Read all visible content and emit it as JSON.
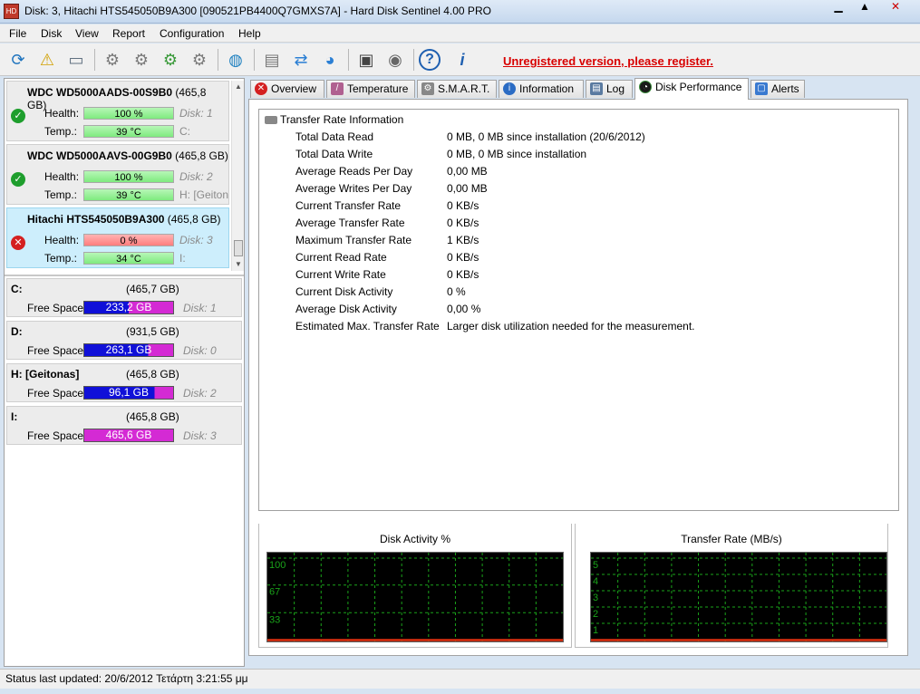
{
  "window": {
    "title": "Disk: 3, Hitachi HTS545050B9A300 [090521PB4400Q7GMXS7A]  -  Hard Disk Sentinel 4.00 PRO",
    "app_icon": "hds-app-icon",
    "controls": [
      "minimize",
      "maximize",
      "close"
    ]
  },
  "menu": {
    "items": [
      "File",
      "Disk",
      "View",
      "Report",
      "Configuration",
      "Help"
    ]
  },
  "toolbar": {
    "buttons": [
      {
        "name": "refresh-icon",
        "glyph": "⟳"
      },
      {
        "name": "warning-icon",
        "glyph": "⚠"
      },
      {
        "name": "disk-icon",
        "glyph": "▭"
      },
      {
        "name": "test-disk-icon",
        "glyph": "⚙"
      },
      {
        "name": "test-disk-2-icon",
        "glyph": "⚙"
      },
      {
        "name": "test-disk-ok-icon",
        "glyph": "⚙"
      },
      {
        "name": "test-disk-3-icon",
        "glyph": "⚙"
      },
      {
        "name": "globe-icon",
        "glyph": "◍"
      },
      {
        "name": "report-icon",
        "glyph": "▤"
      },
      {
        "name": "sync-icon",
        "glyph": "⇄"
      },
      {
        "name": "network-icon",
        "glyph": "◕"
      },
      {
        "name": "monitor-icon",
        "glyph": "▣"
      },
      {
        "name": "sound-icon",
        "glyph": "◉"
      },
      {
        "name": "help-icon",
        "glyph": "?"
      },
      {
        "name": "info-icon",
        "glyph": "i"
      }
    ],
    "register_text": "Unregistered version, please register.",
    "register_color": "#d80000"
  },
  "disks": [
    {
      "model": "WDC WD5000AADS-00S9B0",
      "capacity": "(465,8 GB)",
      "health_label": "Health:",
      "health": "100 %",
      "health_state": "ok",
      "temp_label": "Temp.:",
      "temp": "39 °C",
      "disk_no": "Disk: 1",
      "partition": "C:",
      "selected": false
    },
    {
      "model": "WDC WD5000AAVS-00G9B0",
      "capacity": "(465,8 GB)",
      "health_label": "Health:",
      "health": "100 %",
      "health_state": "ok",
      "temp_label": "Temp.:",
      "temp": "39 °C",
      "disk_no": "Disk: 2",
      "partition": "H: [Geiton",
      "selected": false
    },
    {
      "model": "Hitachi HTS545050B9A300",
      "capacity": "(465,8 GB)",
      "health_label": "Health:",
      "health": "0 %",
      "health_state": "bad",
      "temp_label": "Temp.:",
      "temp": "34 °C",
      "disk_no": "Disk: 3",
      "partition": "I:",
      "selected": true
    }
  ],
  "volumes": [
    {
      "name": "C:",
      "size": "(465,7 GB)",
      "free_label": "Free Space",
      "free": "233,2 GB",
      "used_fraction": 0.5,
      "disk_no": "Disk: 1"
    },
    {
      "name": "D:",
      "size": "(931,5 GB)",
      "free_label": "Free Space",
      "free": "263,1 GB",
      "used_fraction": 0.72,
      "disk_no": "Disk: 0"
    },
    {
      "name": "H: [Geitonas]",
      "size": "(465,8 GB)",
      "free_label": "Free Space",
      "free": "96,1 GB",
      "used_fraction": 0.79,
      "disk_no": "Disk: 2"
    },
    {
      "name": "I:",
      "size": "(465,8 GB)",
      "free_label": "Free Space",
      "free": "465,6 GB",
      "used_fraction": 0.0,
      "disk_no": "Disk: 3"
    }
  ],
  "tabs": [
    {
      "label": "Overview",
      "icon": "error-icon",
      "active": false
    },
    {
      "label": "Temperature",
      "icon": "thermometer-icon",
      "active": false
    },
    {
      "label": "S.M.A.R.T.",
      "icon": "smart-icon",
      "active": false
    },
    {
      "label": "Information",
      "icon": "info-icon",
      "active": false
    },
    {
      "label": "Log",
      "icon": "log-icon",
      "active": false
    },
    {
      "label": "Disk Performance",
      "icon": "performance-icon",
      "active": true
    },
    {
      "label": "Alerts",
      "icon": "alerts-icon",
      "active": false
    }
  ],
  "transfer_info": {
    "title": "Transfer Rate Information",
    "rows": [
      {
        "label": "Total Data Read",
        "value": "0 MB,  0 MB since installation  (20/6/2012)"
      },
      {
        "label": "Total Data Write",
        "value": "0 MB,  0 MB since installation"
      },
      {
        "label": "Average Reads Per Day",
        "value": "0,00 MB"
      },
      {
        "label": "Average Writes Per Day",
        "value": "0,00 MB"
      },
      {
        "label": "Current Transfer Rate",
        "value": "0 KB/s"
      },
      {
        "label": "Average Transfer Rate",
        "value": "0 KB/s"
      },
      {
        "label": "Maximum Transfer Rate",
        "value": "1 KB/s"
      },
      {
        "label": "Current Read Rate",
        "value": "0 KB/s"
      },
      {
        "label": "Current Write Rate",
        "value": "0 KB/s"
      },
      {
        "label": "Current Disk Activity",
        "value": "0 %"
      },
      {
        "label": "Average Disk Activity",
        "value": "0,00 %"
      },
      {
        "label": "Estimated Max. Transfer Rate",
        "value": "Larger disk utilization needed for the measurement."
      }
    ]
  },
  "charts": [
    {
      "title": "Disk Activity %",
      "y_labels": [
        "100",
        "67",
        "33"
      ],
      "ylim": [
        0,
        100
      ],
      "grid_color": "#1aa31a",
      "line_color": "#e03010"
    },
    {
      "title": "Transfer Rate (MB/s)",
      "y_labels": [
        "5",
        "4",
        "3",
        "2",
        "1"
      ],
      "ylim": [
        0,
        5
      ],
      "grid_color": "#1aa31a",
      "line_color": "#e03010"
    }
  ],
  "status": {
    "text": "Status last updated: 20/6/2012 Τετάρτη 3:21:55 μμ"
  }
}
